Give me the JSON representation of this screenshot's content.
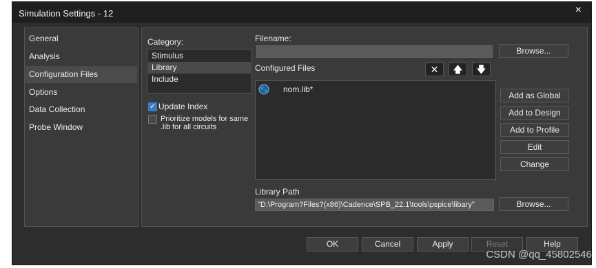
{
  "window": {
    "title": "Simulation Settings - 12",
    "close_glyph": "×"
  },
  "nav": {
    "items": [
      {
        "label": "General"
      },
      {
        "label": "Analysis"
      },
      {
        "label": "Configuration Files",
        "selected": true
      },
      {
        "label": "Options"
      },
      {
        "label": "Data Collection"
      },
      {
        "label": "Probe Window"
      }
    ]
  },
  "category": {
    "label": "Category:",
    "items": [
      {
        "label": "Stimulus"
      },
      {
        "label": "Library",
        "selected": true
      },
      {
        "label": "Include"
      }
    ]
  },
  "options": {
    "update_index": {
      "label": "Update Index",
      "checked": true
    },
    "prioritize": {
      "label_line1": "Prioritize models for same",
      "label_line2": ".lib for all circuits",
      "checked": false
    }
  },
  "filename": {
    "label": "Filename:",
    "value": ""
  },
  "configured_files": {
    "label": "Configured Files",
    "files": [
      {
        "name": "nom.lib*",
        "icon": "globe-icon"
      }
    ],
    "delete_glyph": "✕",
    "up_glyph": "🡅",
    "down_glyph": "🡇"
  },
  "buttons": {
    "browse": "Browse...",
    "add_global": "Add as Global",
    "add_design": "Add to Design",
    "add_profile": "Add to Profile",
    "edit": "Edit",
    "change": "Change",
    "browse2": "Browse..."
  },
  "library_path": {
    "label": "Library Path",
    "value": "\"D:\\Program?Files?(x86)\\Cadence\\SPB_22.1\\tools\\pspice\\libary\""
  },
  "footer": {
    "ok": "OK",
    "cancel": "Cancel",
    "apply": "Apply",
    "reset": "Reset",
    "help": "Help"
  },
  "watermark": "CSDN @qq_45802546"
}
